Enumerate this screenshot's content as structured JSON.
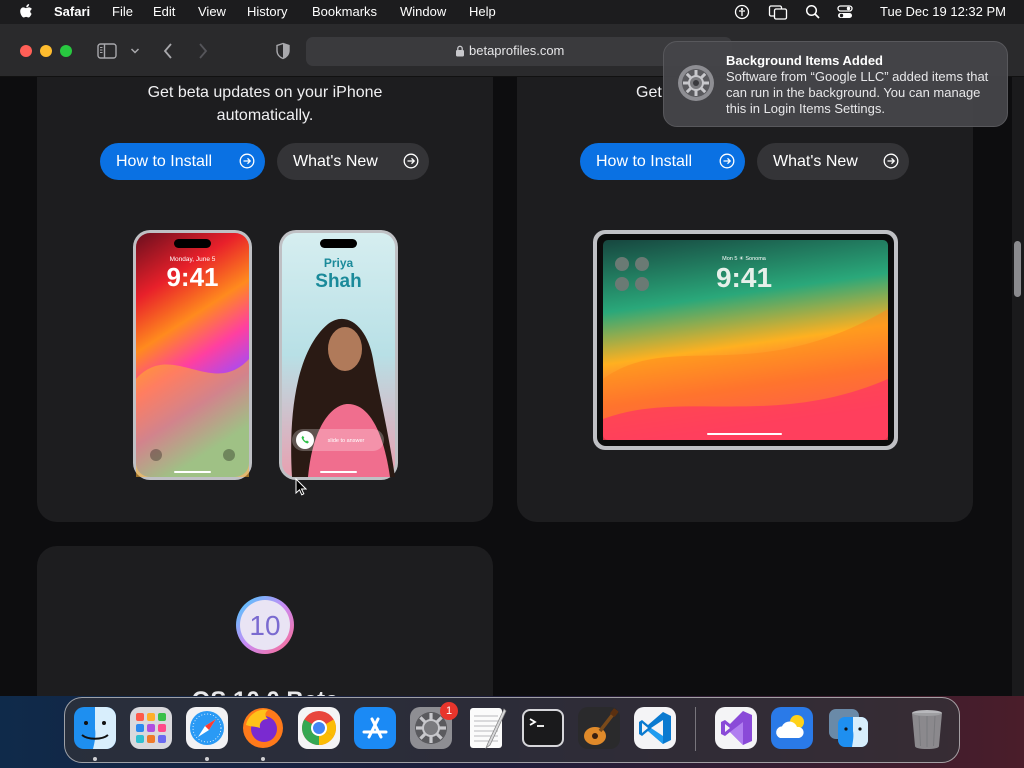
{
  "menubar": {
    "app_name": "Safari",
    "items": [
      "File",
      "Edit",
      "View",
      "History",
      "Bookmarks",
      "Window",
      "Help"
    ],
    "status_icons": [
      "accessibility-icon",
      "screen-mirroring-icon",
      "spotlight-search-icon",
      "control-center-icon"
    ],
    "clock": "Tue Dec 19  12:32 PM"
  },
  "toolbar": {
    "url": "betaprofiles.com",
    "icons": [
      "sidebar-toggle-icon",
      "chevron-down-icon",
      "back-icon",
      "forward-icon",
      "privacy-shield-icon",
      "lock-icon"
    ]
  },
  "notification": {
    "icon": "system-settings-icon",
    "title": "Background Items Added",
    "body": "Software from “Google LLC” added items that can run in the background. You can manage this in Login Items Settings."
  },
  "cards": [
    {
      "text_line1": "Get beta updates on your iPhone",
      "text_line2": "automatically.",
      "install_label": "How to Install",
      "whats_new_label": "What's New",
      "device": "iPhone pair",
      "phone1_date": "Monday, June 5",
      "phone1_time": "9:41",
      "phone2_first_name": "Priya",
      "phone2_last_name": "Shah",
      "phone2_slide": "slide to answer"
    },
    {
      "text_visible": "Get",
      "install_label": "How to Install",
      "whats_new_label": "What's New",
      "device": "iPad",
      "ipad_date": "Mon 5 ☀ Sonoma",
      "ipad_time": "9:41"
    },
    {
      "badge_text": "10",
      "partial_title": "... OS 10 0 Beta"
    }
  ],
  "dock": {
    "apps": [
      "Finder",
      "Launchpad",
      "Safari",
      "Firefox",
      "Google Chrome",
      "App Store",
      "System Settings",
      "TextEdit",
      "Terminal",
      "GarageBand",
      "Visual Studio Code",
      "Visual Studio",
      "Weather",
      "Migration Assistant",
      "Trash"
    ],
    "badge_count": "1",
    "running_indicators": [
      "Finder",
      "Safari",
      "Firefox"
    ]
  },
  "colors": {
    "accent_blue": "#0a71e3",
    "card_bg": "#1d1d1f",
    "page_bg": "#0d0d0f",
    "badge_red": "#e8352c"
  }
}
